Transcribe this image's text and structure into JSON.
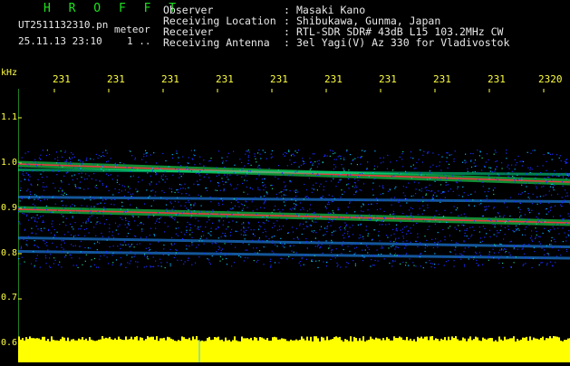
{
  "header": {
    "app_title": "H R O F F T",
    "filename": "UT2511132310.pn",
    "file_tag": "meteor",
    "date_time": "25.11.13 23:10",
    "status_mark": "1 ..",
    "info": [
      {
        "label": "Observer",
        "value": "Masaki Kano"
      },
      {
        "label": "Receiving Location",
        "value": "Shibukawa, Gunma, Japan"
      },
      {
        "label": "Receiver",
        "value": "RTL-SDR SDR# 43dB L15 103.2MHz CW"
      },
      {
        "label": "Receiving Antenna",
        "value": "3el Yagi(V) Az 330 for Vladivostok"
      }
    ],
    "colon": ":"
  },
  "axes": {
    "y_unit": "kHz",
    "y_ticks": [
      "1.1",
      "1.0",
      "0.9",
      "0.8",
      "0.7",
      "0.6"
    ],
    "y_values": [
      1.1,
      1.0,
      0.9,
      0.8,
      0.7,
      0.6
    ],
    "x_ticks": [
      "231",
      "231",
      "231",
      "231",
      "231",
      "231",
      "231",
      "231",
      "231",
      "2320"
    ]
  },
  "spectrogram": {
    "freq_range_khz": [
      0.6,
      1.15
    ],
    "bands": [
      {
        "start_khz": 0.998,
        "end_khz": 0.958,
        "kind": "strong"
      },
      {
        "start_khz": 0.898,
        "end_khz": 0.868,
        "kind": "strong"
      },
      {
        "start_khz": 0.985,
        "end_khz": 0.975,
        "kind": "medium"
      },
      {
        "start_khz": 0.925,
        "end_khz": 0.915,
        "kind": "weak"
      },
      {
        "start_khz": 0.835,
        "end_khz": 0.815,
        "kind": "weak"
      },
      {
        "start_khz": 0.805,
        "end_khz": 0.79,
        "kind": "weak"
      }
    ],
    "noise_top_khz": 1.03,
    "noise_bottom_khz": 0.77
  },
  "colors": {
    "background": "#000000",
    "title": "#20e020",
    "text": "#e8e8e8",
    "accent": "#ffff40",
    "baseline": "#ffff00"
  }
}
